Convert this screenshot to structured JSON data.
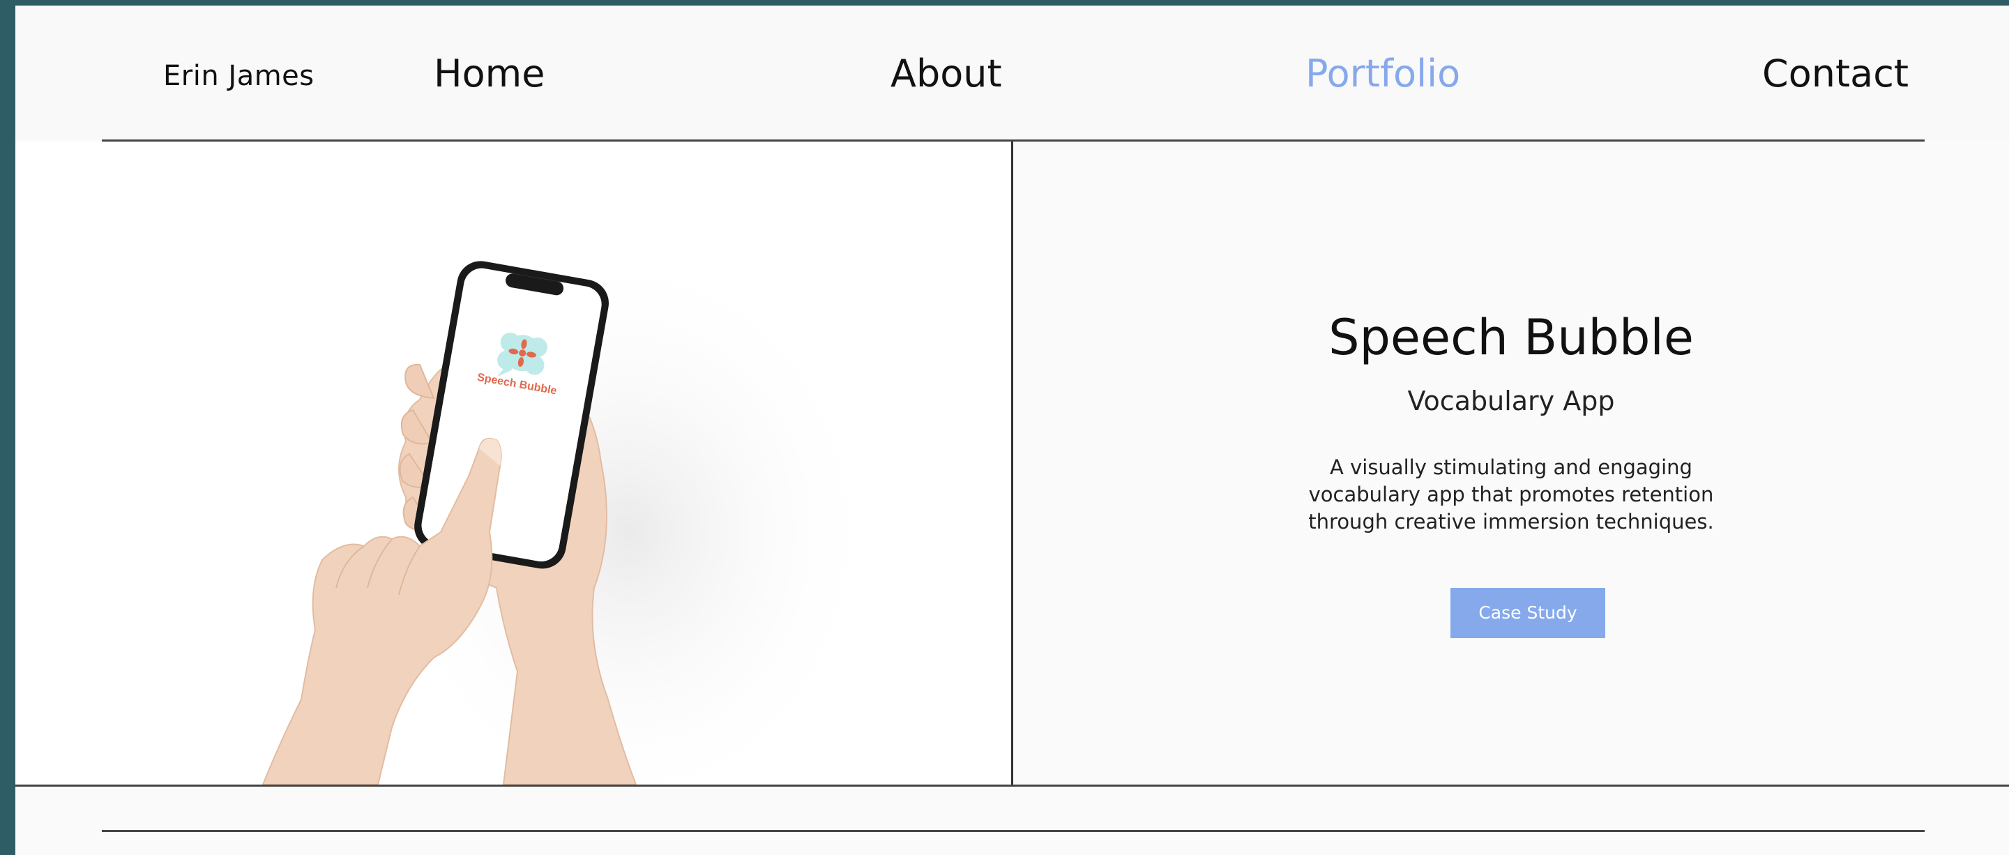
{
  "site": {
    "brand": "Erin James"
  },
  "nav": {
    "items": [
      {
        "label": "Home"
      },
      {
        "label": "About"
      },
      {
        "label": "Portfolio",
        "active": true
      },
      {
        "label": "Contact"
      }
    ],
    "active_color": "#86a9ec"
  },
  "project": {
    "title": "Speech Bubble",
    "subtitle": "Vocabulary App",
    "description": "A visually stimulating and engaging vocabulary app that promotes retention through creative immersion techniques.",
    "button_label": "Case Study",
    "button_color": "#86a9ec",
    "app_logo_text": "Speech Bubble"
  },
  "colors": {
    "frame": "#2f5d66",
    "page_bg": "#fafafa",
    "logo_cloud": "#bfeaea",
    "logo_flower": "#e06a4e"
  }
}
